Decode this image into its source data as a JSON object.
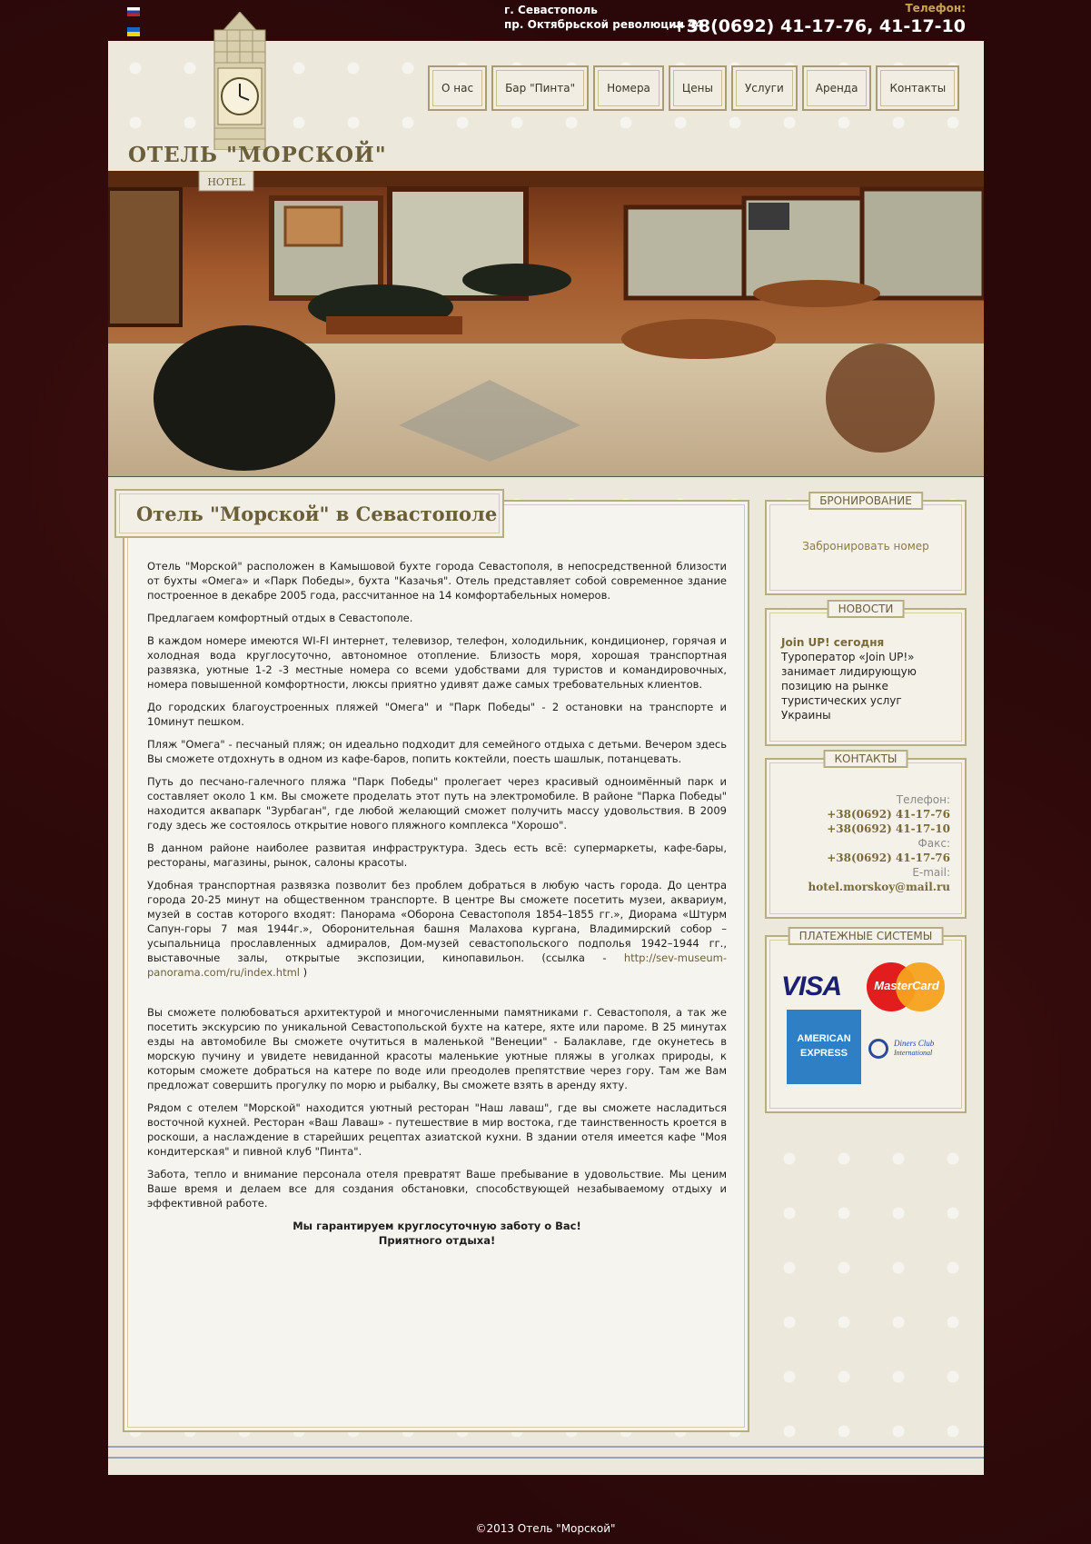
{
  "top": {
    "city": "г. Севастополь",
    "street": "пр. Октябрьской революции 44",
    "phone_label": "Телефон:",
    "phone": "+38(0692) 41-17-76, 41-17-10"
  },
  "header": {
    "hotel_name": "ОТЕЛЬ \"МОРСКОЙ\"",
    "banner_sign": "HOTEL"
  },
  "nav": {
    "items": [
      "О нас",
      "Бар \"Пинта\"",
      "Номера",
      "Цены",
      "Услуги",
      "Аренда",
      "Контакты"
    ]
  },
  "content": {
    "title": "Отель \"Морской\" в Севастополе",
    "p1": "Отель \"Морской\" расположен в Камышовой бухте города Севастополя, в непосредственной близости  от бухты «Омега» и «Парк Победы», бухта \"Казачья\". Отель представляет собой современное здание построенное в декабре 2005 года, рассчитанное на 14 комфортабельных номеров.",
    "p2": "Предлагаем комфортный отдых в Севастополе.",
    "p3": "В каждом номере имеются WI-FI интернет, телевизор, телефон, холодильник, кондиционер, горячая и холодная вода круглосуточно, автономное отопление. Близость моря, хорошая транспортная развязка, уютные 1-2 -3 местные номера со всеми удобствами для туристов и командировочных, номера повышенной комфортности, люксы приятно удивят даже самых требовательных клиентов.",
    "p4": "До городских благоустроенных пляжей \"Омега\" и \"Парк Победы\" - 2 остановки на транспорте и 10минут пешком.",
    "p5": "Пляж \"Омега\" - песчаный пляж; он идеально подходит для семейного отдыха с детьми. Вечером здесь Вы сможете отдохнуть в одном из кафе-баров, попить коктейли, поесть шашлык, потанцевать.",
    "p6": "Путь до песчано-галечного пляжа \"Парк Победы\"  пролегает через красивый одноимённый парк и составляет около 1 км. Вы сможете проделать этот путь на электромобиле. В районе \"Парка Победы\" находится аквапарк \"Зурбаган\", где любой желающий сможет получить массу удовольствия. В 2009 году здесь же состоялось открытие нового пляжного комплекса \"Хорошо\".",
    "p7": " В данном районе наиболее развитая инфраструктура. Здесь есть всё: супермаркеты, кафе-бары, рестораны, магазины, рынок, салоны красоты.",
    "p8": "Удобная транспортная развязка позволит без проблем добраться в любую часть города. До центра города 20-25 минут на общественном транспорте. В центре Вы сможете посетить музеи, аквариум,  музей в состав которого входят: Панорама «Оборона Севастополя 1854–1855 гг.», Диорама «Штурм Сапун-горы 7 мая 1944г.», Оборонительная башня Малахова кургана, Владимирский собор – усыпальница прославленных адмиралов, Дом-музей севастопольского подполья 1942–1944 гг., выставочные залы, открытые экспозиции, кинопавильон. (ссылка - ",
    "p8_link": "http://sev-museum-panorama.com/ru/index.html",
    "p8_end": " )",
    "p9": "Вы сможете полюбоваться архитектурой и многочисленными памятниками г. Севастополя, а так же посетить экскурсию по уникальной Севастопольской бухте на катере, яхте или пароме. В 25 минутах езды на автомобиле Вы сможете очутиться в маленькой \"Венеции\" - Балаклаве, где окунетесь в морскую пучину и увидете невиданной красоты маленькие уютные пляжы в уголках природы, к которым сможете добраться на катере по воде или преодолев препятствие через гору. Там же Вам предложат совершить прогулку по морю  и рыбалку, Вы сможете взять в аренду яхту.",
    "p10": "Рядом с отелем \"Морской\" находится уютный ресторан \"Наш лаваш\", где вы сможете насладиться восточной кухней. Ресторан «Ваш Лаваш» - путешествие в мир востока, где таинственность кроется в роскоши, а наслаждение в старейших рецептах азиатской кухни. В здании отеля имеется кафе \"Моя кондитерская\" и пивной клуб \"Пинта\".",
    "p11": "Забота, тепло и внимание персонала отеля превратят Ваше пребывание в удовольствие. Мы ценим Ваше время и делаем все для создания обстановки, способствующей незабываемому отдыху и эффективной работе.",
    "closing1": "Мы гарантируем круглосуточную заботу о Вас!",
    "closing2": "Приятного отдыха!"
  },
  "sidebar": {
    "booking": {
      "label": "БРОНИРОВАНИЕ",
      "link": "Забронировать номер"
    },
    "news": {
      "label": "НОВОСТИ",
      "title": "Join UP! сегодня",
      "text": "Туроператор «Join UP!» занимает лидирующую позицию на рынке туристических услуг Украины"
    },
    "contacts": {
      "label": "КОНТАКТЫ",
      "phone_label": "Телефон:",
      "phone1": "+38(0692) 41-17-76",
      "phone2": "+38(0692) 41-17-10",
      "fax_label": "Факс:",
      "fax": "+38(0692) 41-17-76",
      "email_label": "E-mail:",
      "email": "hotel.morskoy@mail.ru"
    },
    "payments": {
      "label": "ПЛАТЕЖНЫЕ СИСТЕМЫ",
      "visa": "VISA",
      "mastercard": "MasterCard",
      "amex_line1": "AMERICAN",
      "amex_line2": "EXPRESS",
      "diners_line1": "Diners Club",
      "diners_line2": "International"
    }
  },
  "footer": {
    "copyright": "©2013 Отель \"Морской\""
  },
  "colors": {
    "accent": "#6b5f3a",
    "background": "#2a0809",
    "page": "#ece8dc"
  }
}
